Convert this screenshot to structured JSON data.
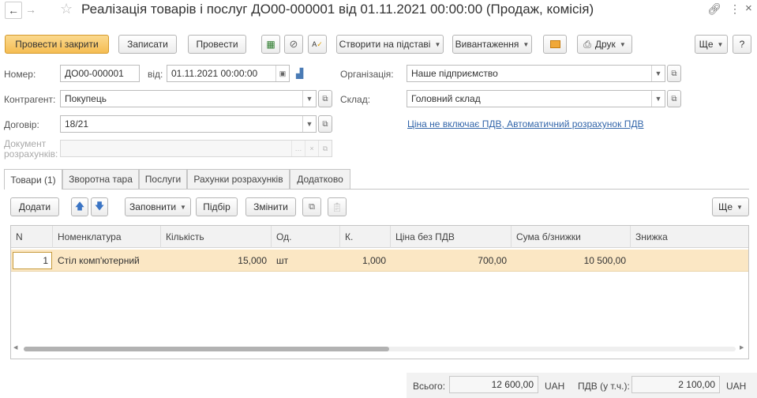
{
  "window": {
    "title": "Реалізація товарів і послуг ДО00-000001 від 01.11.2021 00:00:00 (Продаж, комісія)"
  },
  "toolbar": {
    "post_close": "Провести і закрити",
    "save": "Записати",
    "post": "Провести",
    "create_basis": "Створити на підставі",
    "upload": "Вивантаження",
    "print": "Друк",
    "more": "Ще",
    "help": "?"
  },
  "form": {
    "number_label": "Номер:",
    "number_value": "ДО00-000001",
    "date_label": "від:",
    "date_value": "01.11.2021 00:00:00",
    "org_label": "Організація:",
    "org_value": "Наше підприємство",
    "counterparty_label": "Контрагент:",
    "counterparty_value": "Покупець",
    "warehouse_label": "Склад:",
    "warehouse_value": "Головний склад",
    "contract_label": "Договір:",
    "contract_value": "18/21",
    "price_link": "Ціна не включає ПДВ, Автоматичний розрахунок ПДВ",
    "settlement_doc_label_1": "Документ",
    "settlement_doc_label_2": "розрахунків:"
  },
  "tabs": [
    {
      "label": "Товари (1)"
    },
    {
      "label": "Зворотна тара"
    },
    {
      "label": "Послуги"
    },
    {
      "label": "Рахунки розрахунків"
    },
    {
      "label": "Додатково"
    }
  ],
  "table_toolbar": {
    "add": "Додати",
    "fill": "Заповнити",
    "select": "Підбір",
    "change": "Змінити",
    "more": "Ще"
  },
  "table": {
    "columns": [
      "N",
      "Номенклатура",
      "Кількість",
      "Од.",
      "К.",
      "Ціна без ПДВ",
      "Сума б/знижки",
      "Знижка"
    ],
    "rows": [
      {
        "n": "1",
        "item": "Стіл комп'ютерний",
        "qty": "15,000",
        "unit": "шт",
        "k": "1,000",
        "price": "700,00",
        "sum": "10 500,00",
        "discount": ""
      }
    ]
  },
  "totals": {
    "total_label": "Всього:",
    "total_value": "12 600,00",
    "currency": "UAH",
    "vat_label": "ПДВ (у т.ч.):",
    "vat_value": "2 100,00",
    "vat_currency": "UAH"
  },
  "colors": {
    "accent": "#f5bd52",
    "selected_row": "#fbe7c4",
    "link": "#3366aa"
  }
}
